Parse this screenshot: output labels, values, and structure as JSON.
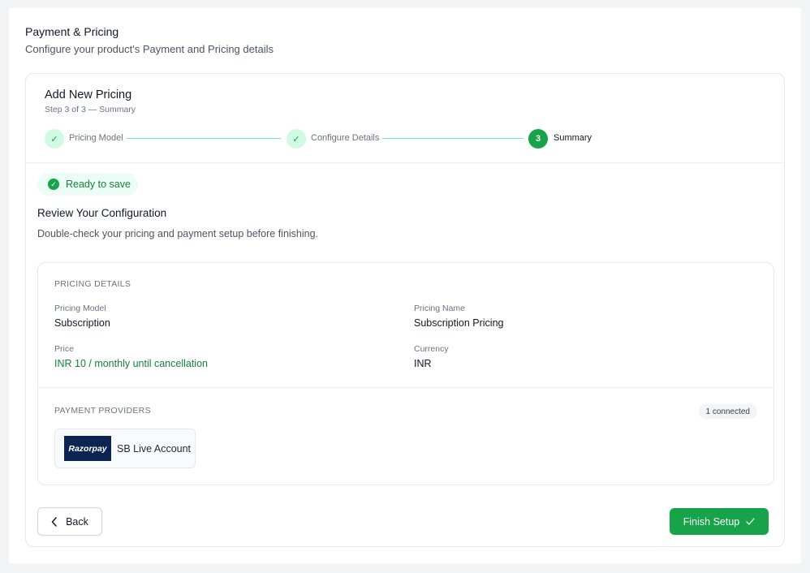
{
  "header": {
    "title": "Payment & Pricing",
    "subtitle": "Configure your product's Payment and Pricing details"
  },
  "card": {
    "title": "Add New Pricing",
    "step_text": "Step 3 of 3 — Summary"
  },
  "stepper": {
    "steps": [
      {
        "label": "Pricing Model",
        "state": "done",
        "marker": "✓"
      },
      {
        "label": "Configure Details",
        "state": "done",
        "marker": "✓"
      },
      {
        "label": "Summary",
        "state": "active",
        "marker": "3"
      }
    ]
  },
  "status": {
    "badge": "Ready to save",
    "icon": "check-circle-icon"
  },
  "review": {
    "title": "Review Your Configuration",
    "subtitle": "Double-check your pricing and payment setup before finishing."
  },
  "pricing_details": {
    "section_label": "PRICING DETAILS",
    "pricing_model_label": "Pricing Model",
    "pricing_model": "Subscription",
    "pricing_name_label": "Pricing Name",
    "pricing_name": "Subscription Pricing",
    "price_label": "Price",
    "price": "INR 10 / monthly until cancellation",
    "currency_label": "Currency",
    "currency": "INR"
  },
  "payment_providers": {
    "section_label": "PAYMENT PROVIDERS",
    "connected_count": "1 connected",
    "providers": [
      {
        "logo_text": "Razorpay",
        "name": "SB Live Account"
      }
    ]
  },
  "actions": {
    "back_label": "Back",
    "finish_label": "Finish Setup"
  },
  "colors": {
    "accent": "#16a34a",
    "accent_light": "#d1fae5",
    "razorpay_brand": "#0c2451"
  }
}
